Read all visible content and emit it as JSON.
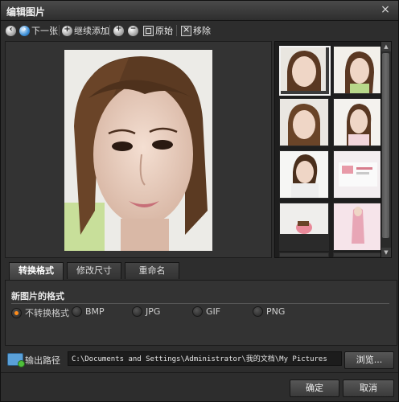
{
  "window": {
    "title": "编辑图片",
    "close_label": "×"
  },
  "toolbar": {
    "next_label": "下一张",
    "add_label": "继续添加",
    "original_label": "原始",
    "remove_label": "移除"
  },
  "tabs": [
    {
      "label": "转换格式",
      "active": true
    },
    {
      "label": "修改尺寸",
      "active": false
    },
    {
      "label": "重命名",
      "active": false
    }
  ],
  "format_section": {
    "title": "新图片的格式",
    "options": [
      {
        "label": "不转换格式",
        "selected": true
      },
      {
        "label": "BMP",
        "selected": false
      },
      {
        "label": "JPG",
        "selected": false
      },
      {
        "label": "GIF",
        "selected": false
      },
      {
        "label": "PNG",
        "selected": false
      }
    ]
  },
  "output": {
    "label": "输出路径",
    "path": "C:\\Documents and Settings\\Administrator\\我的文档\\My Pictures",
    "browse_label": "浏览..."
  },
  "buttons": {
    "ok_label": "确定",
    "cancel_label": "取消"
  },
  "colors": {
    "accent_radio": "#ff8c1a",
    "background": "#2d2d2d"
  },
  "icons": [
    "previous-icon",
    "next-icon",
    "add-icon",
    "zoom-in-icon",
    "zoom-out-icon",
    "original-size-icon",
    "remove-icon",
    "folder-icon"
  ]
}
